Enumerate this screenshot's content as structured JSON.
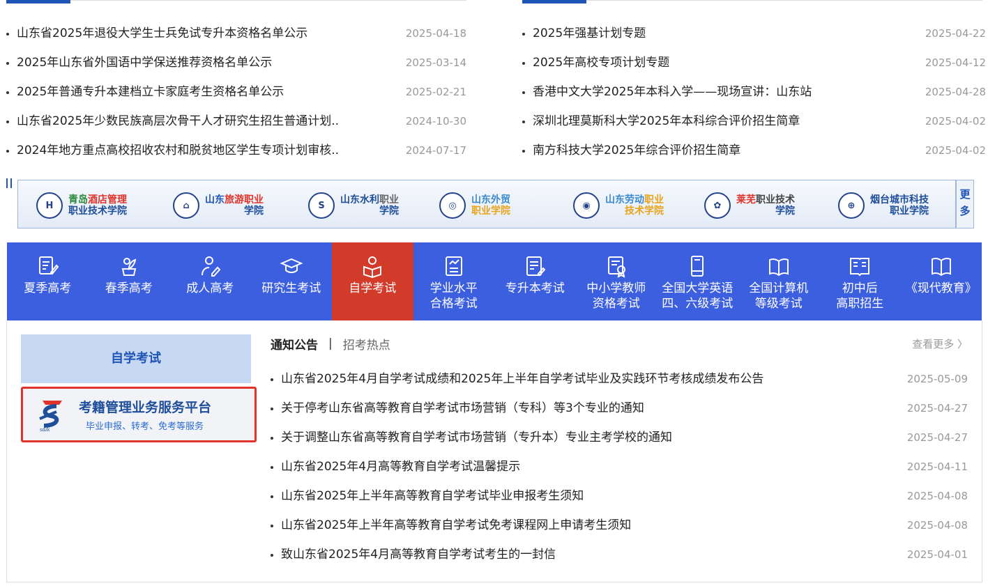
{
  "top_news_left": [
    {
      "title": "山东省2025年退役大学生士兵免试专升本资格名单公示",
      "date": "2025-04-18"
    },
    {
      "title": "2025年山东省外国语中学保送推荐资格名单公示",
      "date": "2025-03-14"
    },
    {
      "title": "2025年普通专升本建档立卡家庭考生资格名单公示",
      "date": "2025-02-21"
    },
    {
      "title": "山东省2025年少数民族高层次骨干人才研究生招生普通计划..",
      "date": "2024-10-30"
    },
    {
      "title": "2024年地方重点高校招收农村和脱贫地区学生专项计划审核..",
      "date": "2024-07-17"
    }
  ],
  "top_news_right": [
    {
      "title": "2025年强基计划专题",
      "date": "2025-04-22"
    },
    {
      "title": "2025年高校专项计划专题",
      "date": "2025-04-12"
    },
    {
      "title": "香港中文大学2025年本科入学——现场宣讲：山东站",
      "date": "2025-04-28"
    },
    {
      "title": "深圳北理莫斯科大学2025年本科综合评价招生简章",
      "date": "2025-04-02"
    },
    {
      "title": "南方科技大学2025年综合评价招生简章",
      "date": "2025-04-02"
    }
  ],
  "logos": [
    {
      "line1a": "青岛",
      "line1b": "酒店管理",
      "line2": "职业技术学院",
      "color1": "#2a8a3a",
      "color2": "#e0342b"
    },
    {
      "line1a": "山东",
      "line1b": "旅游职业",
      "line2": "学院",
      "color1": "#1f55b6",
      "color2": "#e0342b"
    },
    {
      "line1a": "山东水利",
      "line1b": "职业",
      "line2": "学院",
      "color1": "#1f4e9a",
      "color2": "#666"
    },
    {
      "line1a": "山东外贸",
      "line1b": "",
      "line2": "职业学院",
      "color1": "#3a8ad0",
      "color2": "#e8a41a"
    },
    {
      "line1a": "山东劳动",
      "line1b": "职业",
      "line2": "技术学院",
      "color1": "#3a8ad0",
      "color2": "#e8a41a"
    },
    {
      "line1a": "莱芜",
      "line1b": "职业技术",
      "line2": "学院",
      "color1": "#e0342b",
      "color2": "#444"
    },
    {
      "line1a": "烟台城市科技",
      "line1b": "",
      "line2": "职业学院",
      "color1": "#1f4e9a",
      "color2": "#1f4e9a"
    }
  ],
  "logo_more": "更多",
  "nav": [
    {
      "label": "夏季高考",
      "icon": "pen-paper-icon",
      "active": false
    },
    {
      "label": "春季高考",
      "icon": "flower-pot-icon",
      "active": false
    },
    {
      "label": "成人高考",
      "icon": "person-write-icon",
      "active": false
    },
    {
      "label": "研究生考试",
      "icon": "graduation-cap-icon",
      "active": false
    },
    {
      "label": "自学考试",
      "icon": "reader-icon",
      "active": true
    },
    {
      "label": "学业水平\n合格考试",
      "icon": "document-chart-icon",
      "active": false
    },
    {
      "label": "专升本考试",
      "icon": "document-pen-icon",
      "active": false
    },
    {
      "label": "中小学教师\n资格考试",
      "icon": "certificate-icon",
      "active": false
    },
    {
      "label": "全国大学英语\n四、六级考试",
      "icon": "book-icon",
      "active": false
    },
    {
      "label": "全国计算机\n等级考试",
      "icon": "open-book-icon",
      "active": false
    },
    {
      "label": "初中后\n高职招生",
      "icon": "book-pages-icon",
      "active": false
    },
    {
      "label": "《现代教育》",
      "icon": "magazine-icon",
      "active": false
    }
  ],
  "side": {
    "heading": "自学考试",
    "card_title": "考籍管理业务服务平台",
    "card_sub": "毕业申报、转考、免考等服务",
    "emblem_text": "sdzk"
  },
  "notice": {
    "tab_active": "通知公告",
    "tab_sep": "|",
    "tab_other": "招考热点",
    "more": "查看更多 〉",
    "items": [
      {
        "title": "山东省2025年4月自学考试成绩和2025年上半年自学考试毕业及实践环节考核成绩发布公告",
        "date": "2025-05-09"
      },
      {
        "title": "关于停考山东省高等教育自学考试市场营销（专科）等3个专业的通知",
        "date": "2025-04-27"
      },
      {
        "title": "关于调整山东省高等教育自学考试市场营销（专升本）专业主考学校的通知",
        "date": "2025-04-27"
      },
      {
        "title": "山东省2025年4月高等教育自学考试温馨提示",
        "date": "2025-04-11"
      },
      {
        "title": "山东省2025年上半年高等教育自学考试毕业申报考生须知",
        "date": "2025-04-08"
      },
      {
        "title": "山东省2025年上半年高等教育自学考试免考课程网上申请考生须知",
        "date": "2025-04-08"
      },
      {
        "title": "致山东省2025年4月高等教育自学考试考生的一封信",
        "date": "2025-04-01"
      }
    ]
  },
  "colors": {
    "nav_bg": "#3c5fe0",
    "nav_active": "#d23b2a",
    "accent": "#1f55b6"
  }
}
